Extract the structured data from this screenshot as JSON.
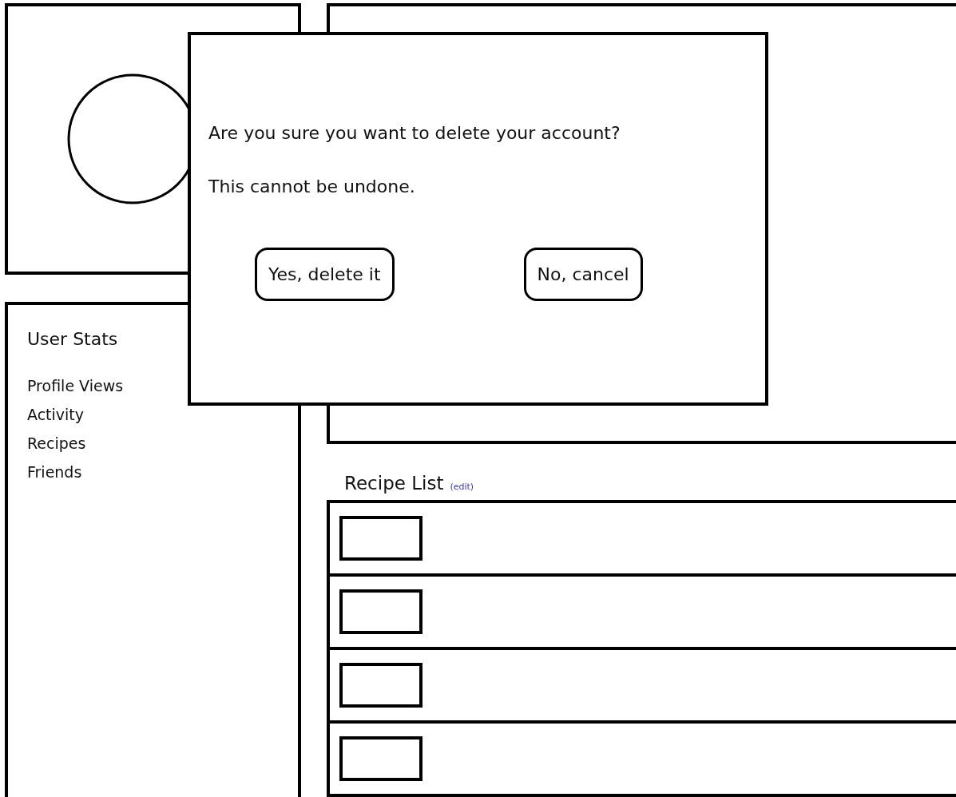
{
  "stats": {
    "title": "User Stats",
    "items": [
      "Profile Views",
      "Activity",
      "Recipes",
      "Friends"
    ]
  },
  "recipe_list": {
    "title": "Recipe List",
    "edit_link": "(edit)",
    "rows": [
      {
        "kind": "thumbnail-row"
      },
      {
        "kind": "thumbnail-row"
      },
      {
        "kind": "thumbnail-row"
      },
      {
        "kind": "thumbnail-row"
      }
    ]
  },
  "dialog": {
    "message": "Are you sure you want to delete your account?",
    "note": "This cannot be undone.",
    "buttons": [
      "Yes, delete it",
      "No, cancel"
    ]
  }
}
